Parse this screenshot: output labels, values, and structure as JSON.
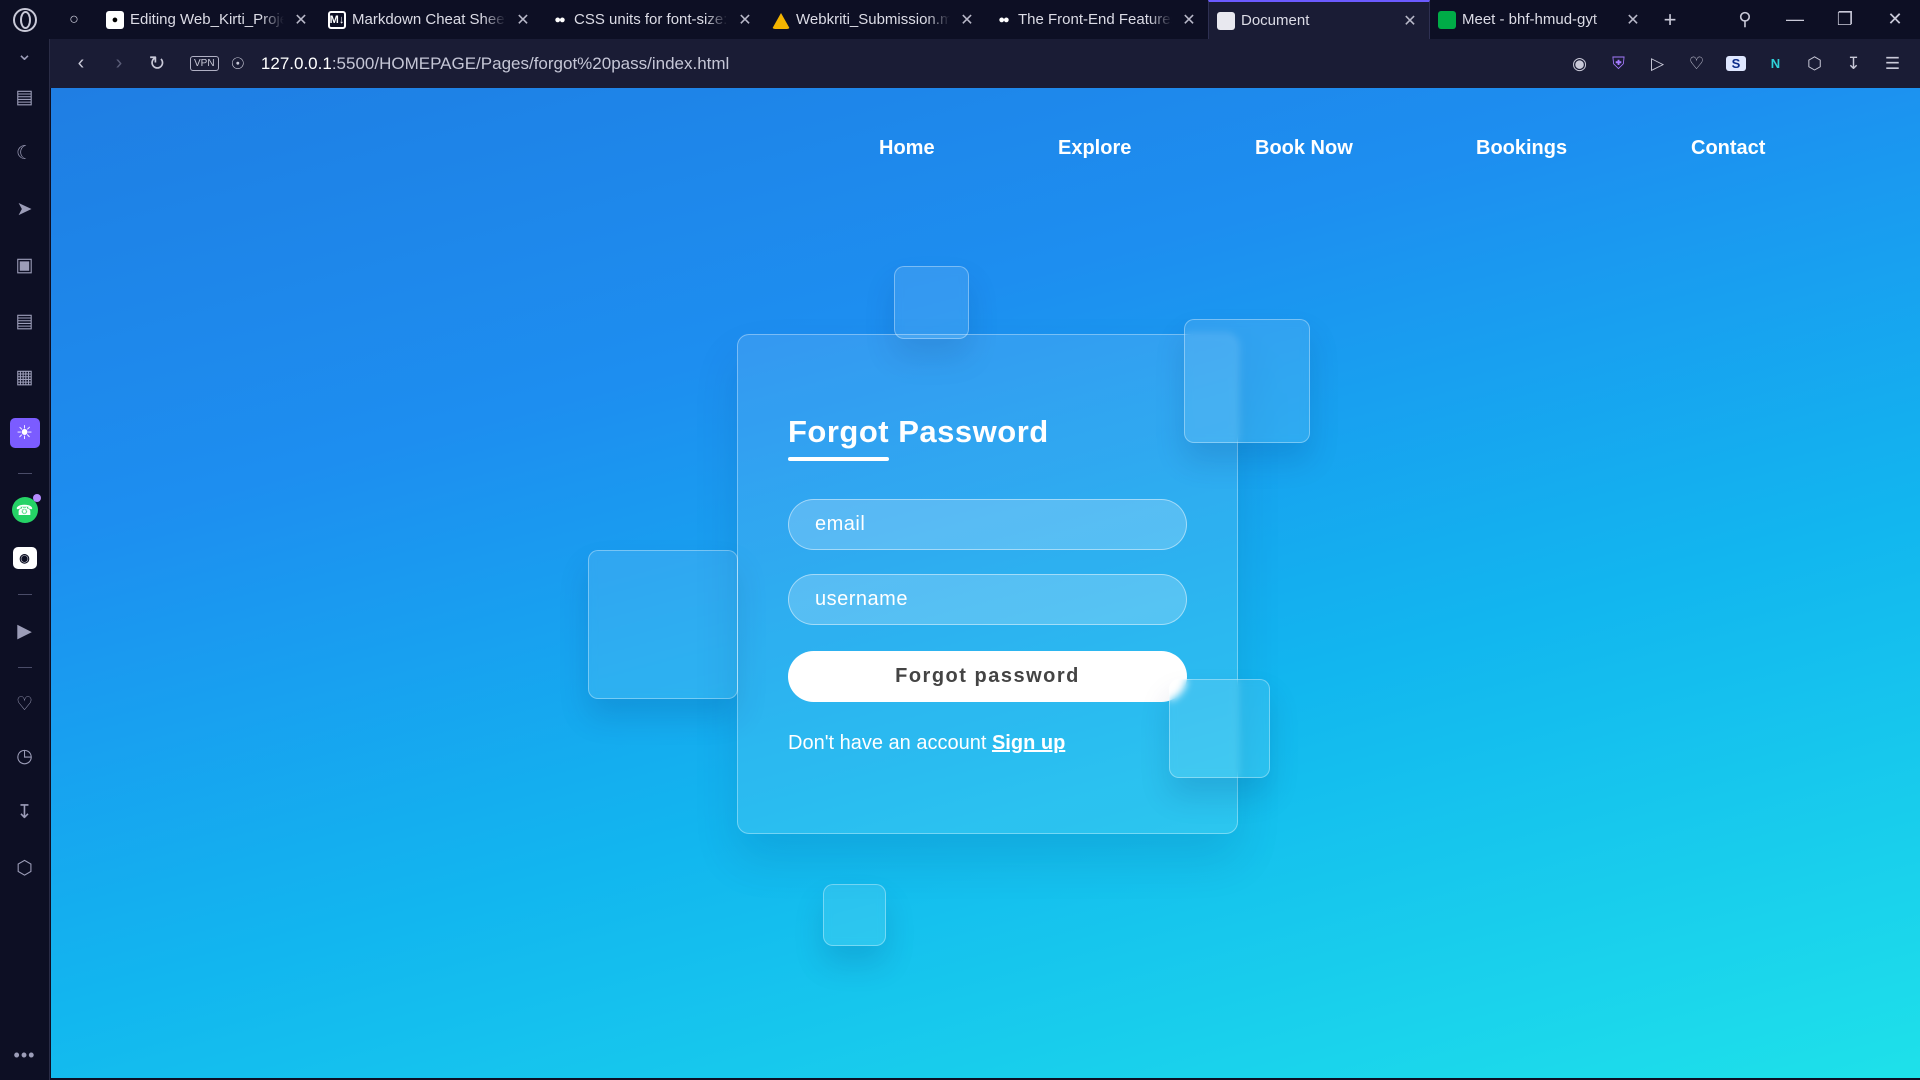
{
  "browser": {
    "tabs": [
      {
        "icon": "github-icon",
        "title": "Editing Web_Kirti_Proje",
        "active": false
      },
      {
        "icon": "markdown-icon",
        "title": "Markdown Cheat Sheet",
        "active": false
      },
      {
        "icon": "medium-icon",
        "title": "CSS units for font-size:",
        "active": false
      },
      {
        "icon": "google-drive-icon",
        "title": "Webkriti_Submission.m",
        "active": false
      },
      {
        "icon": "medium-icon",
        "title": "The Front-End Features",
        "active": false
      },
      {
        "icon": "document-icon",
        "title": "Document",
        "active": true
      },
      {
        "icon": "google-meet-icon",
        "title": "Meet - bhf-hmud-gyt",
        "active": false
      }
    ],
    "address": {
      "vpn_label": "VPN",
      "url_host": "127.0.0.1",
      "url_path": ":5500/HOMEPAGE/Pages/forgot%20pass/index.html"
    },
    "sidebar_icons": [
      "chevron-down-icon",
      "book-icon",
      "moon-icon",
      "rocket-icon",
      "gamepad-icon",
      "news-icon",
      "gift-icon",
      "sun-icon",
      "whatsapp-icon",
      "discord-icon",
      "play-icon",
      "heart-icon",
      "clock-icon",
      "download-icon",
      "cube-icon",
      "more-icon"
    ]
  },
  "page": {
    "nav": {
      "home": "Home",
      "explore": "Explore",
      "book_now": "Book Now",
      "bookings": "Bookings",
      "contact": "Contact"
    },
    "form": {
      "title": "Forgot Password",
      "email_placeholder": "email",
      "username_placeholder": "username",
      "submit_label": "Forgot password",
      "signup_prompt": "Don't have an account ",
      "signup_link": "Sign up"
    },
    "colors": {
      "gradient_top": "#1f7ee3",
      "gradient_bottom": "#1ee1ea",
      "accent_tab": "#6b5bff",
      "sidebar_active": "#7b5cff"
    }
  }
}
